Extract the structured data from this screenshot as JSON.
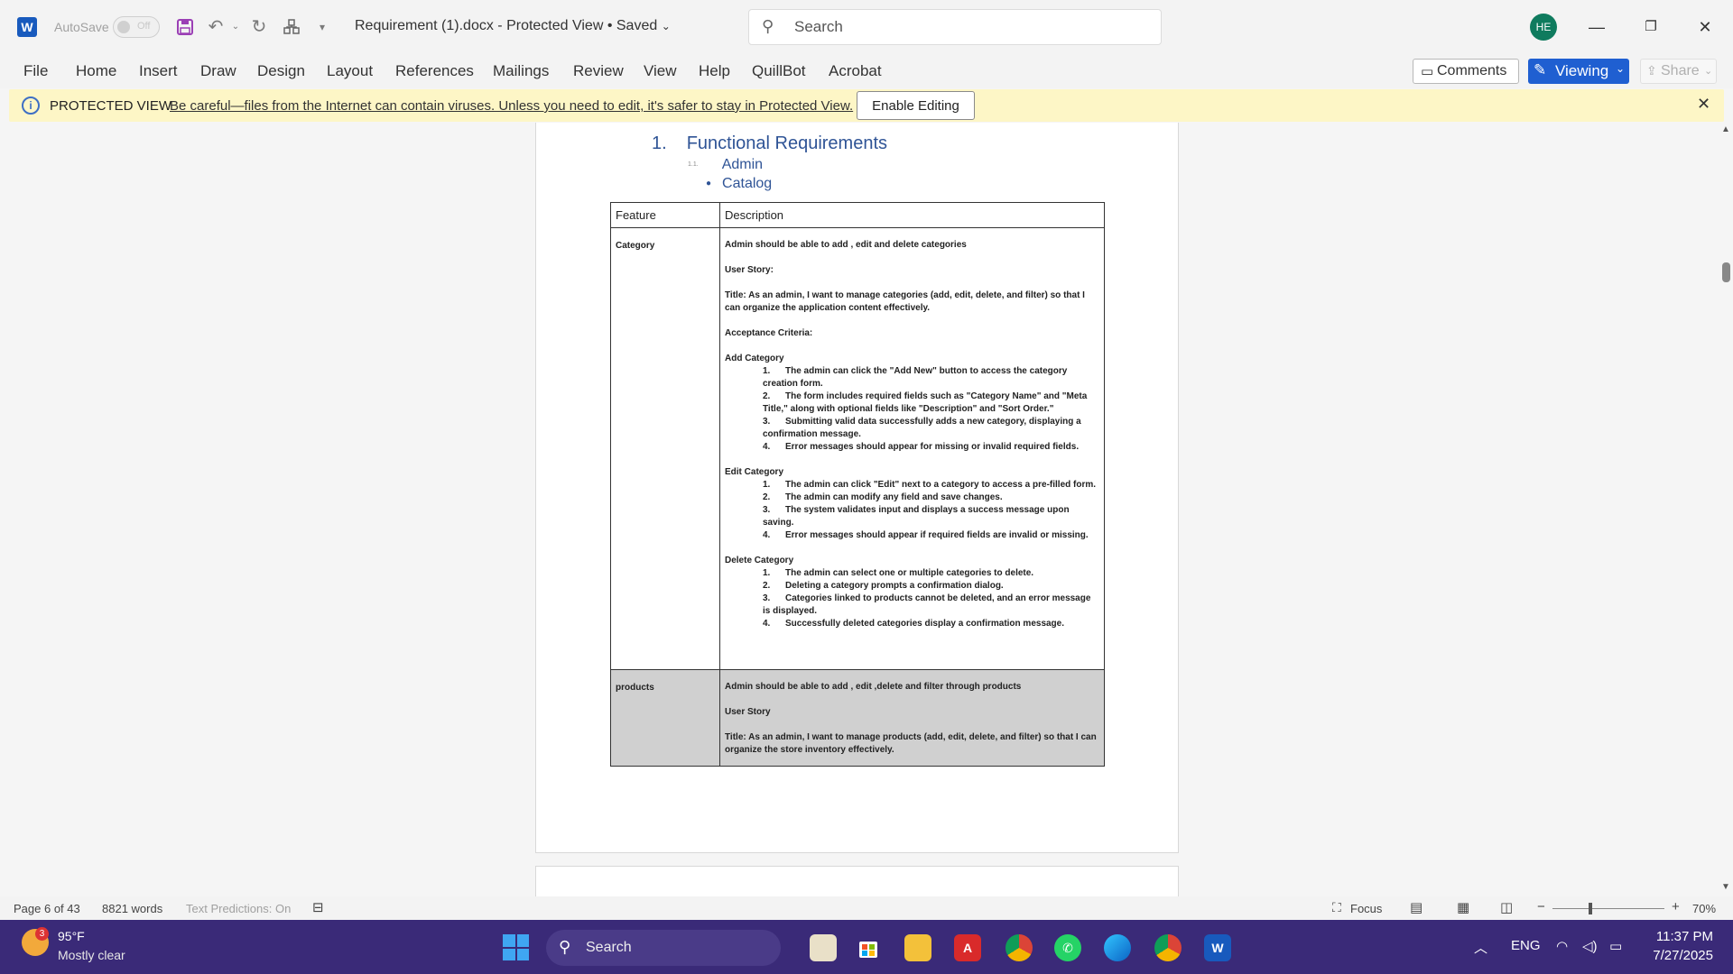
{
  "titlebar": {
    "app_logo": "W",
    "autosave_label": "AutoSave",
    "autosave_state": "Off",
    "doc_title": "Requirement (1).docx  -  Protected View • Saved",
    "search_placeholder": "Search",
    "avatar_initials": "HE"
  },
  "ribbon": {
    "tabs": [
      "File",
      "Home",
      "Insert",
      "Draw",
      "Design",
      "Layout",
      "References",
      "Mailings",
      "Review",
      "View",
      "Help",
      "QuillBot",
      "Acrobat"
    ],
    "comments_label": "Comments",
    "viewing_label": "Viewing",
    "share_label": "Share"
  },
  "protected_view": {
    "title": "PROTECTED VIEW",
    "message": "Be careful—files from the Internet can contain viruses. Unless you need to edit, it's safer to stay in Protected View.",
    "enable_label": "Enable Editing"
  },
  "document": {
    "h1_num": "1.",
    "h1": "Functional Requirements",
    "h2_num": "1.1.",
    "h2": "Admin",
    "h3_bullet": "●",
    "h3": "Catalog",
    "table": {
      "header_feature": "Feature",
      "header_description": "Description",
      "category": {
        "feature": "Category",
        "summary": "Admin should be able to add , edit  and delete categories",
        "user_story_label": "User Story:",
        "title": "Title: As an admin, I want to manage categories (add, edit, delete, and filter) so that I can organize the application content effectively.",
        "acceptance_label": "Acceptance Criteria:",
        "add_label": "Add Category",
        "add_items": [
          "The admin can click the \"Add New\" button to access the category creation form.",
          "The form includes required fields such as \"Category Name\" and \"Meta Title,\" along with optional fields like \"Description\" and \"Sort Order.\"",
          "Submitting valid data successfully adds a new category, displaying a confirmation message.",
          "Error messages should appear for missing or invalid required fields."
        ],
        "edit_label": "Edit Category",
        "edit_items": [
          "The admin can click \"Edit\" next to a category to access a pre-filled form.",
          "The admin can modify any field and save changes.",
          "The system validates input and displays a success message upon saving.",
          "Error messages should appear if required fields are invalid or missing."
        ],
        "delete_label": "Delete Category",
        "delete_items": [
          "The admin can select one or multiple categories to delete.",
          "Deleting a category prompts a confirmation dialog.",
          "Categories linked to products cannot be deleted, and an error message is displayed.",
          "Successfully deleted categories display a confirmation message."
        ]
      },
      "products": {
        "feature": "products",
        "summary": "Admin should be able to add , edit ,delete and filter through products",
        "user_story_label": "User Story",
        "title": "Title: As an admin, I want to manage products (add, edit, delete, and filter) so that I can organize the store inventory effectively."
      }
    }
  },
  "statusbar": {
    "page": "Page 6 of 43",
    "words": "8821 words",
    "predictions": "Text Predictions: On",
    "focus": "Focus",
    "zoom_minus": "−",
    "zoom_plus": "+",
    "zoom": "70%"
  },
  "taskbar": {
    "weather_badge": "3",
    "temp": "95°F",
    "weather": "Mostly clear",
    "search_label": "Search",
    "lang": "ENG",
    "time": "11:37 PM",
    "date": "7/27/2025"
  }
}
